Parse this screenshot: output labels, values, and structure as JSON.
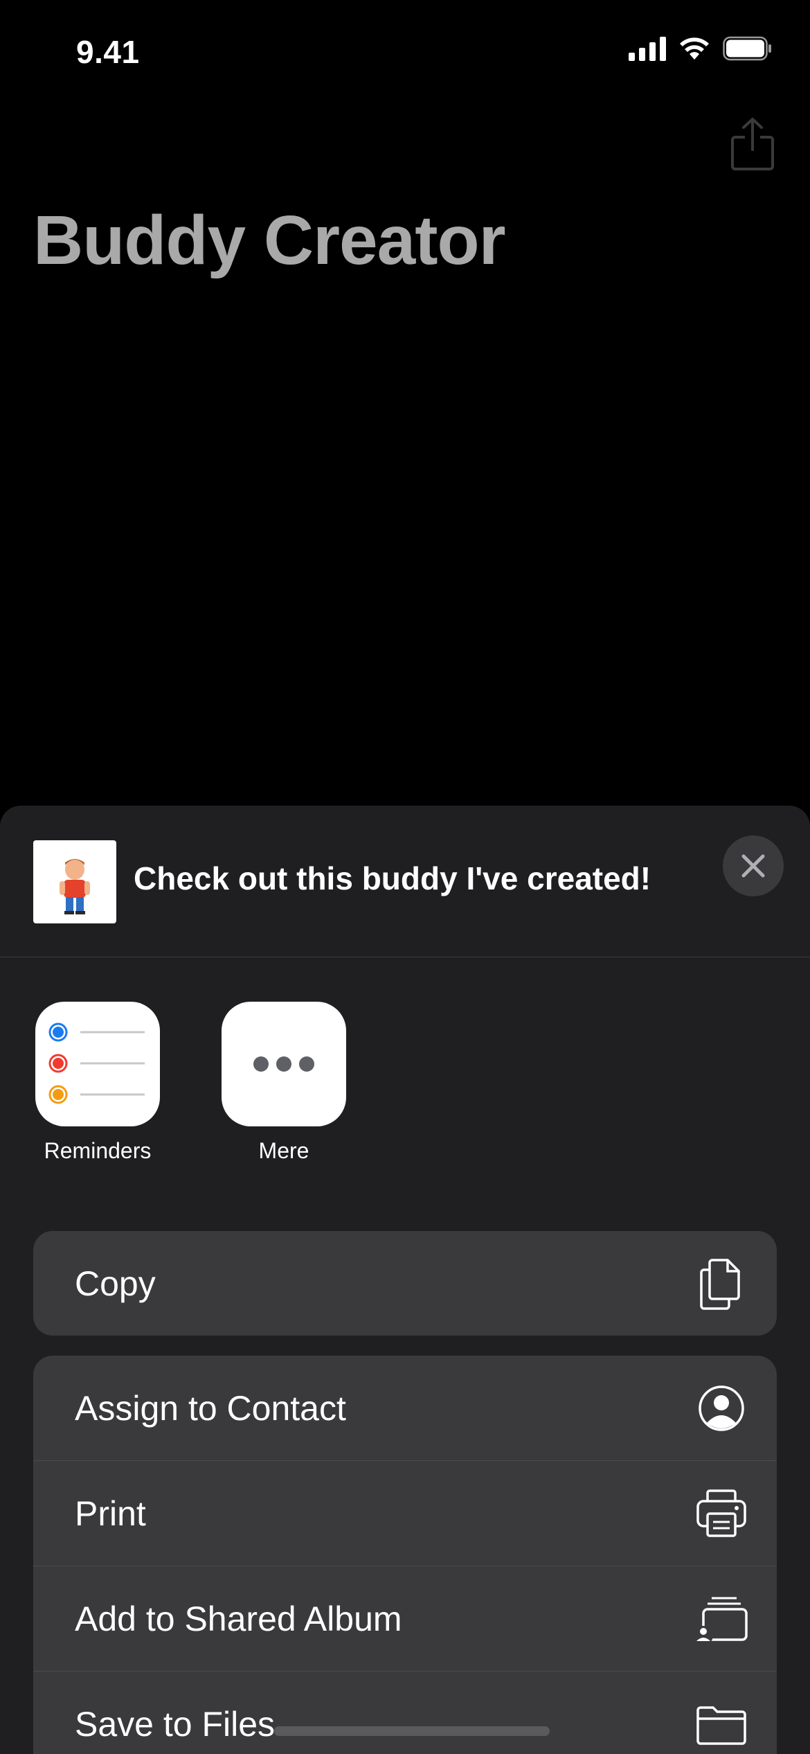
{
  "status_bar": {
    "time": "9.41"
  },
  "page": {
    "title": "Buddy Creator"
  },
  "share_sheet": {
    "message": "Check out this buddy I've created!",
    "apps": [
      {
        "label": "Reminders",
        "icon": "reminders-icon"
      },
      {
        "label": "Mere",
        "icon": "more-icon"
      }
    ],
    "actions_primary": [
      {
        "label": "Copy",
        "icon": "copy-icon"
      }
    ],
    "actions_secondary": [
      {
        "label": "Assign to Contact",
        "icon": "person-circle-icon"
      },
      {
        "label": "Print",
        "icon": "printer-icon"
      },
      {
        "label": "Add to Shared Album",
        "icon": "shared-album-icon"
      },
      {
        "label": "Save to Files",
        "icon": "folder-icon"
      }
    ]
  },
  "colors": {
    "background": "#000000",
    "sheet": "#1f1f21",
    "row": "#3a3a3c",
    "title": "#a9a9a9",
    "reminder_blue": "#1a7cf0",
    "reminder_red": "#ef3b2f",
    "reminder_orange": "#f39c12"
  }
}
